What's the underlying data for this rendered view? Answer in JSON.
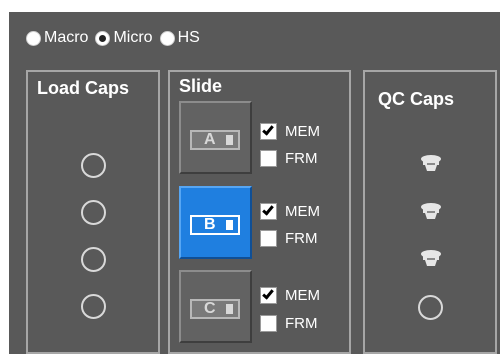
{
  "mode": {
    "options": [
      {
        "label": "Macro",
        "selected": false
      },
      {
        "label": "Micro",
        "selected": true
      },
      {
        "label": "HS",
        "selected": false
      }
    ]
  },
  "load_caps": {
    "title": "Load Caps",
    "slots": [
      "empty",
      "empty",
      "empty",
      "empty"
    ]
  },
  "slide": {
    "title": "Slide",
    "slides": [
      {
        "letter": "A",
        "active": false,
        "mem_label": "MEM",
        "mem_checked": true,
        "frm_label": "FRM",
        "frm_checked": false
      },
      {
        "letter": "B",
        "active": true,
        "mem_label": "MEM",
        "mem_checked": true,
        "frm_label": "FRM",
        "frm_checked": false
      },
      {
        "letter": "C",
        "active": false,
        "mem_label": "MEM",
        "mem_checked": true,
        "frm_label": "FRM",
        "frm_checked": false
      }
    ]
  },
  "qc_caps": {
    "title": "QC Caps",
    "slots": [
      "cap",
      "cap",
      "cap",
      "empty"
    ]
  },
  "colors": {
    "panel_bg": "#595959",
    "active_slide": "#1f7fe0",
    "group_border": "#a6a6a6"
  }
}
